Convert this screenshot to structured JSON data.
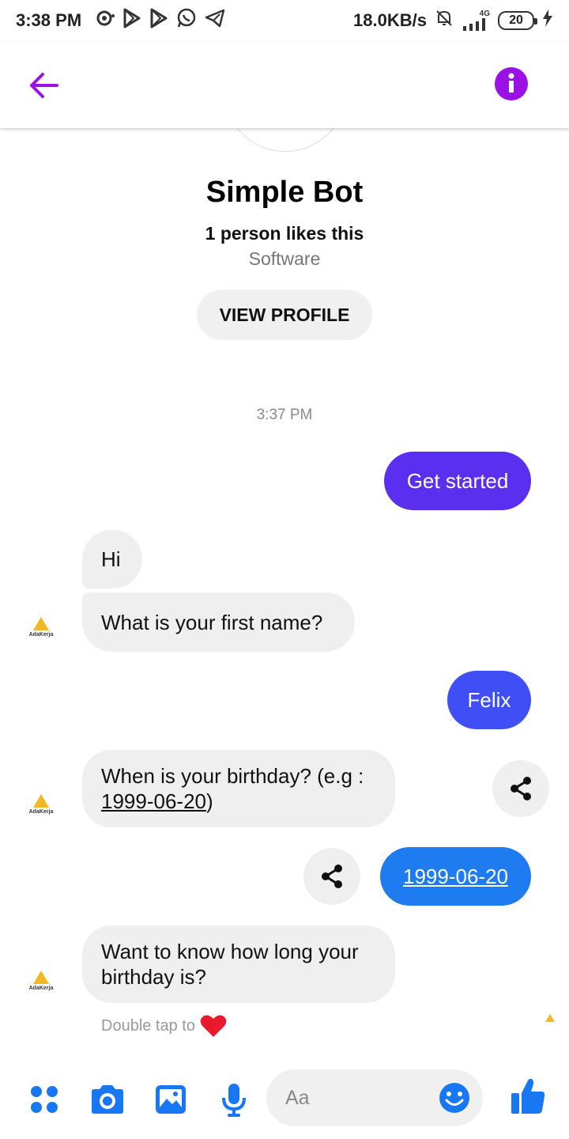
{
  "status_bar": {
    "time": "3:38 PM",
    "net_speed": "18.0KB/s",
    "network": "4G",
    "battery": "20"
  },
  "app_bar": {
    "back_icon": "arrow-left-icon",
    "info_icon": "info-icon",
    "accent_color": "#9b11e3"
  },
  "profile": {
    "name": "Simple Bot",
    "likes": "1 person likes this",
    "category": "Software",
    "view_profile_label": "VIEW PROFILE"
  },
  "conversation": {
    "timestamp": "3:37 PM",
    "messages": [
      {
        "from": "user",
        "text": "Get started",
        "color": "#5b2ff0"
      },
      {
        "from": "bot",
        "text": "Hi"
      },
      {
        "from": "bot",
        "text": "What is your first name?"
      },
      {
        "from": "user",
        "text": "Felix",
        "color": "#3f4ff5"
      },
      {
        "from": "bot",
        "text_prefix": "When is your birthday? (e.g :",
        "link": "1999-06-20",
        "text_suffix": ")"
      },
      {
        "from": "user",
        "text": "1999-06-20",
        "color": "#1f7bf0"
      },
      {
        "from": "bot",
        "text": "Want to know how long your birthday is?"
      }
    ],
    "bot_avatar_brand": "AdaKerja",
    "double_tap_hint": "Double tap to",
    "heart_icon": "heart-icon"
  },
  "composer": {
    "placeholder": "Aa",
    "icon_color": "#1877f2",
    "icons": [
      "menu-dots-icon",
      "camera-icon",
      "gallery-icon",
      "microphone-icon",
      "emoji-icon",
      "thumbs-up-icon"
    ]
  }
}
